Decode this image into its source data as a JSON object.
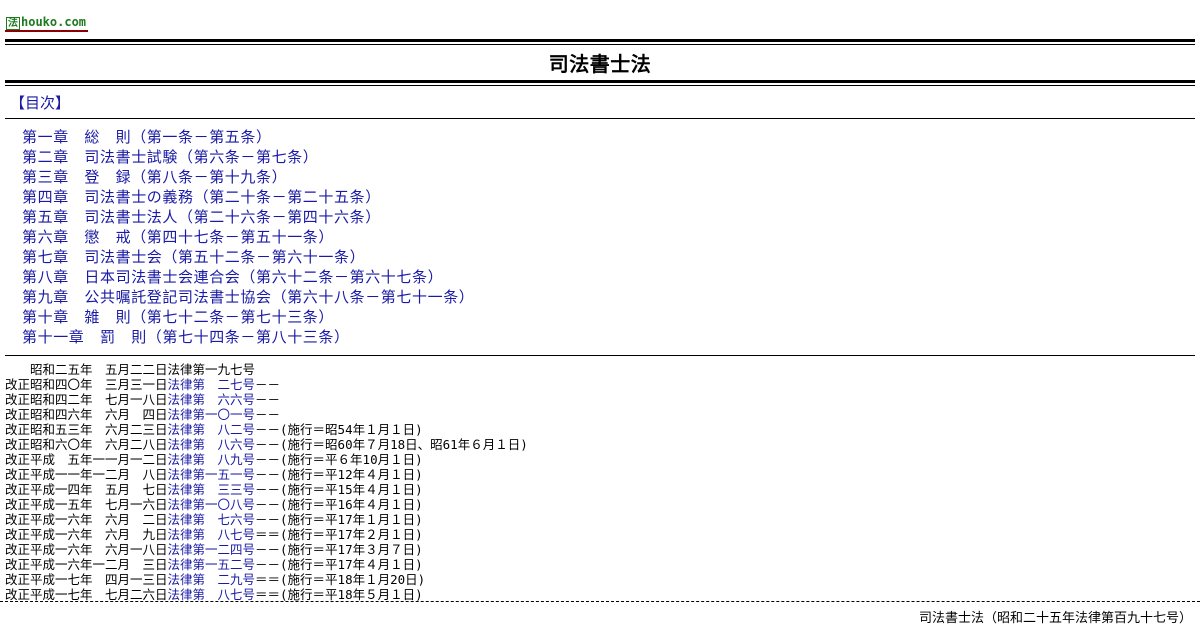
{
  "logo": {
    "mark": "法",
    "text": "houko.com"
  },
  "title": "司法書士法",
  "toc": {
    "heading": "【目次】",
    "chapters": [
      "第一章　総　則（第一条－第五条）",
      "第二章　司法書士試験（第六条－第七条）",
      "第三章　登　録（第八条－第十九条）",
      "第四章　司法書士の義務（第二十条－第二十五条）",
      "第五章　司法書士法人（第二十六条－第四十六条）",
      "第六章　懲　戒（第四十七条－第五十一条）",
      "第七章　司法書士会（第五十二条－第六十一条）",
      "第八章　日本司法書士会連合会（第六十二条－第六十七条）",
      "第九章　公共嘱託登記司法書士協会（第六十八条－第七十一条）",
      "第十章　雑　則（第七十二条－第七十三条）",
      "第十一章　罰　則（第七十四条－第八十三条）"
    ]
  },
  "history": [
    {
      "date": "　　昭和二五年　五月二二日",
      "law": "法律第一九七号",
      "link": false,
      "note": ""
    },
    {
      "date": "改正昭和四〇年　三月三一日",
      "law": "法律第　二七号",
      "link": true,
      "note": "－－"
    },
    {
      "date": "改正昭和四二年　七月一八日",
      "law": "法律第　六六号",
      "link": true,
      "note": "－－"
    },
    {
      "date": "改正昭和四六年　六月　四日",
      "law": "法律第一〇一号",
      "link": true,
      "note": "－－"
    },
    {
      "date": "改正昭和五三年　六月二三日",
      "law": "法律第　八二号",
      "link": true,
      "note": "－－(施行＝昭54年１月１日)"
    },
    {
      "date": "改正昭和六〇年　六月二八日",
      "law": "法律第　八六号",
      "link": true,
      "note": "－－(施行＝昭60年７月18日、昭61年６月１日)"
    },
    {
      "date": "改正平成　五年一一月一二日",
      "law": "法律第　八九号",
      "link": true,
      "note": "－－(施行＝平６年10月１日)"
    },
    {
      "date": "改正平成一一年一二月　八日",
      "law": "法律第一五一号",
      "link": true,
      "note": "－－(施行＝平12年４月１日)"
    },
    {
      "date": "改正平成一四年　五月　七日",
      "law": "法律第　三三号",
      "link": true,
      "note": "－－(施行＝平15年４月１日)"
    },
    {
      "date": "改正平成一五年　七月一六日",
      "law": "法律第一〇八号",
      "link": true,
      "note": "－－(施行＝平16年４月１日)"
    },
    {
      "date": "改正平成一六年　六月　二日",
      "law": "法律第　七六号",
      "link": true,
      "note": "－－(施行＝平17年１月１日)"
    },
    {
      "date": "改正平成一六年　六月　九日",
      "law": "法律第　八七号",
      "link": true,
      "note": "＝＝(施行＝平17年２月１日)"
    },
    {
      "date": "改正平成一六年　六月一八日",
      "law": "法律第一二四号",
      "link": true,
      "note": "－－(施行＝平17年３月７日)"
    },
    {
      "date": "改正平成一六年一二月　三日",
      "law": "法律第一五二号",
      "link": true,
      "note": "－－(施行＝平17年４月１日)"
    },
    {
      "date": "改正平成一七年　四月一三日",
      "law": "法律第　二九号",
      "link": true,
      "note": "＝＝(施行＝平18年１月20日)"
    },
    {
      "date": "改正平成一七年　七月二六日",
      "law": "法律第　八七号",
      "link": true,
      "note": "＝＝(施行＝平18年５月１日)"
    }
  ],
  "footer": "司法書士法（昭和二十五年法律第百九十七号）"
}
